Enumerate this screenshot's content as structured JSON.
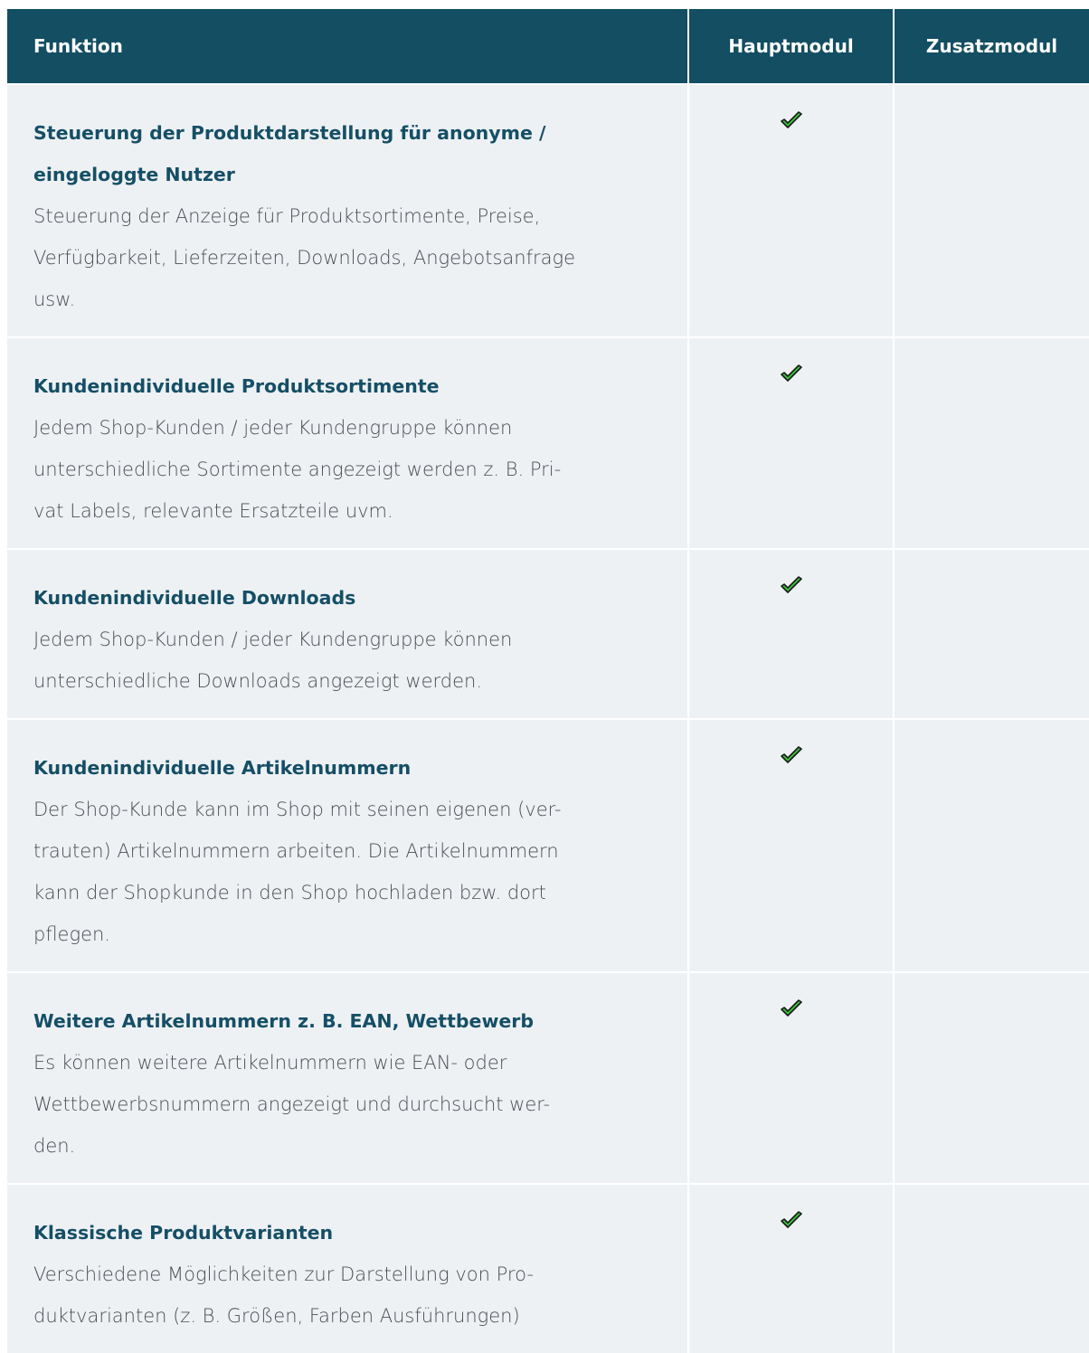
{
  "header": {
    "feature": "Funktion",
    "main_module": "Hauptmodul",
    "addon_module": "Zusatzmodul"
  },
  "colors": {
    "header_bg": "#134e62",
    "row_bg": "#eef1f4",
    "title_color": "#154f66",
    "check_color": "#3cc33c"
  },
  "rows": [
    {
      "title_lines": [
        "Steuerung der Produktdarstellung für anonyme /",
        "eingeloggte Nutzer"
      ],
      "desc_lines": [
        "Steuerung der Anzeige für Produktsortimente, Preise,",
        "Verfügbarkeit, Lieferzeiten, Downloads, Angebotsanfrage",
        "usw."
      ],
      "main_module": "check-icon",
      "addon_module": ""
    },
    {
      "title_lines": [
        "Kundenindividuelle Produktsortimente"
      ],
      "desc_lines": [
        "Jedem Shop-Kunden / jeder Kundengruppe können",
        "unterschiedliche Sortimente angezeigt werden z. B. Pri-",
        "vat Labels, relevante Ersatzteile uvm."
      ],
      "main_module": "check-icon",
      "addon_module": ""
    },
    {
      "title_lines": [
        "Kundenindividuelle Downloads"
      ],
      "desc_lines": [
        "Jedem Shop-Kunden / jeder Kundengruppe können",
        "unterschiedliche Downloads angezeigt werden."
      ],
      "main_module": "check-icon",
      "addon_module": ""
    },
    {
      "title_lines": [
        "Kundenindividuelle Artikelnummern"
      ],
      "desc_lines": [
        "Der Shop-Kunde kann im Shop mit seinen eigenen (ver-",
        "trauten) Artikelnummern arbeiten. Die Artikelnummern",
        "kann der  Shopkunde in den Shop hochladen bzw. dort",
        "pflegen."
      ],
      "main_module": "check-icon",
      "addon_module": ""
    },
    {
      "title_lines": [
        "Weitere Artikelnummern z. B. EAN, Wettbewerb"
      ],
      "desc_lines": [
        "Es können weitere Artikelnummern wie EAN- oder",
        "Wettbewerbsnummern angezeigt und durchsucht wer-",
        "den."
      ],
      "main_module": "check-icon",
      "addon_module": ""
    },
    {
      "title_lines": [
        "Klassische Produktvarianten"
      ],
      "desc_lines": [
        "Verschiedene Möglichkeiten zur Darstellung von Pro-",
        "duktvarianten (z. B. Größen, Farben Ausführungen)"
      ],
      "main_module": "check-icon",
      "addon_module": ""
    }
  ]
}
